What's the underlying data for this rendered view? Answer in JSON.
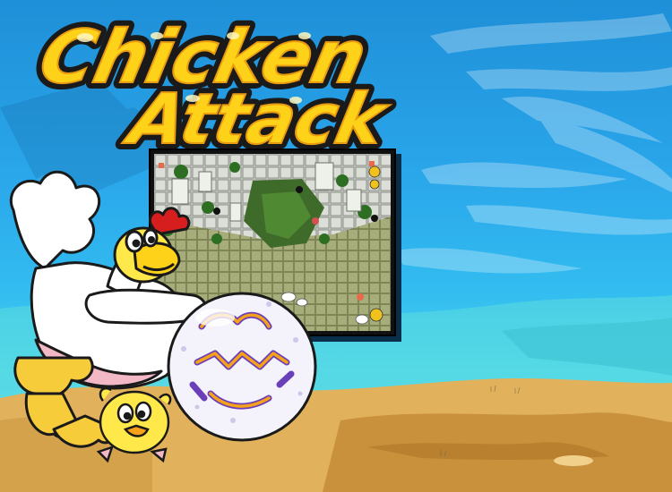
{
  "title": {
    "line1": "Chicken",
    "line2": "Attack"
  },
  "colors": {
    "sky_top": "#1e8fd8",
    "sky_bottom": "#6fe3e6",
    "sand": "#e0b05a",
    "sand_shadow": "#c48a3a",
    "logo_fill": "#ffd21a",
    "logo_outline": "#1a1a1a",
    "ball_purple": "#6a3fb8",
    "ball_orange": "#f5a21a"
  },
  "icons": {
    "game_preview": "game-screenshot-thumbnail",
    "hero": "chicken-mascot",
    "ball": "magic-ball",
    "chick": "baby-chick"
  }
}
